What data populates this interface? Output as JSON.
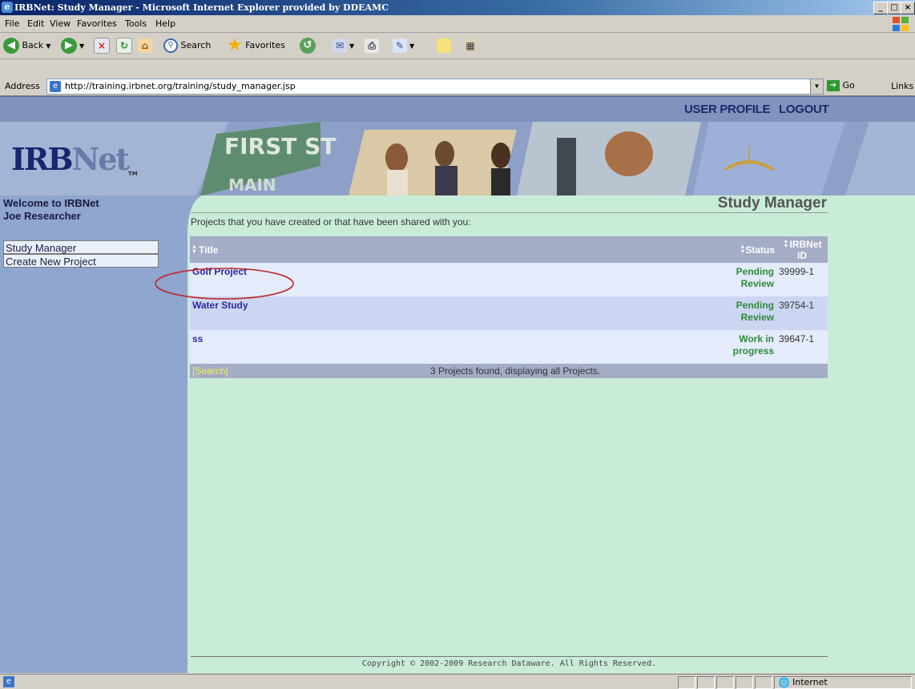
{
  "window": {
    "title": "IRBNet: Study Manager - Microsoft Internet Explorer provided by DDEAMC",
    "min": "_",
    "max": "□",
    "close": "×"
  },
  "menubar": [
    "File",
    "Edit",
    "View",
    "Favorites",
    "Tools",
    "Help"
  ],
  "toolbar": {
    "back": "Back",
    "search": "Search",
    "favorites": "Favorites"
  },
  "address": {
    "label": "Address",
    "url": "http://training.irbnet.org/training/study_manager.jsp",
    "go": "Go",
    "links": "Links"
  },
  "nav": {
    "user_profile": "USER PROFILE",
    "logout": "LOGOUT"
  },
  "banner": {
    "logo_main": "IRB",
    "logo_net": "Net",
    "logo_tm": "TM",
    "sign_text": "FIRST ST",
    "sign_text2": "MAIN"
  },
  "sidebar": {
    "welcome": "Welcome to IRBNet",
    "user": "Joe Researcher",
    "items": [
      "Study Manager",
      "Create New Project"
    ]
  },
  "main": {
    "title": "Study Manager",
    "intro": "Projects that you have created or that have been shared with you:",
    "columns": [
      "Title",
      "Status",
      "IRBNet ID"
    ],
    "rows": [
      {
        "title": "Golf Project",
        "status": "Pending Review",
        "id": "39999-1"
      },
      {
        "title": "Water Study",
        "status": "Pending Review",
        "id": "39754-1"
      },
      {
        "title": "ss",
        "status": "Work in progress",
        "id": "39647-1"
      }
    ],
    "search_link": "[Search]",
    "summary": "3 Projects found, displaying all Projects."
  },
  "footer": {
    "copyright": "Copyright © 2002-2009 Research Dataware. All Rights Reserved."
  },
  "statusbar": {
    "zone": "Internet"
  },
  "colors": {
    "page_bg": "#c9ecd9",
    "nav_bg": "#7f93bd",
    "sidebar_bg": "#8fa6cf",
    "link_blue": "#2a2aa0",
    "status_green": "#2e8b3a",
    "annotation_red": "#c0282e"
  }
}
